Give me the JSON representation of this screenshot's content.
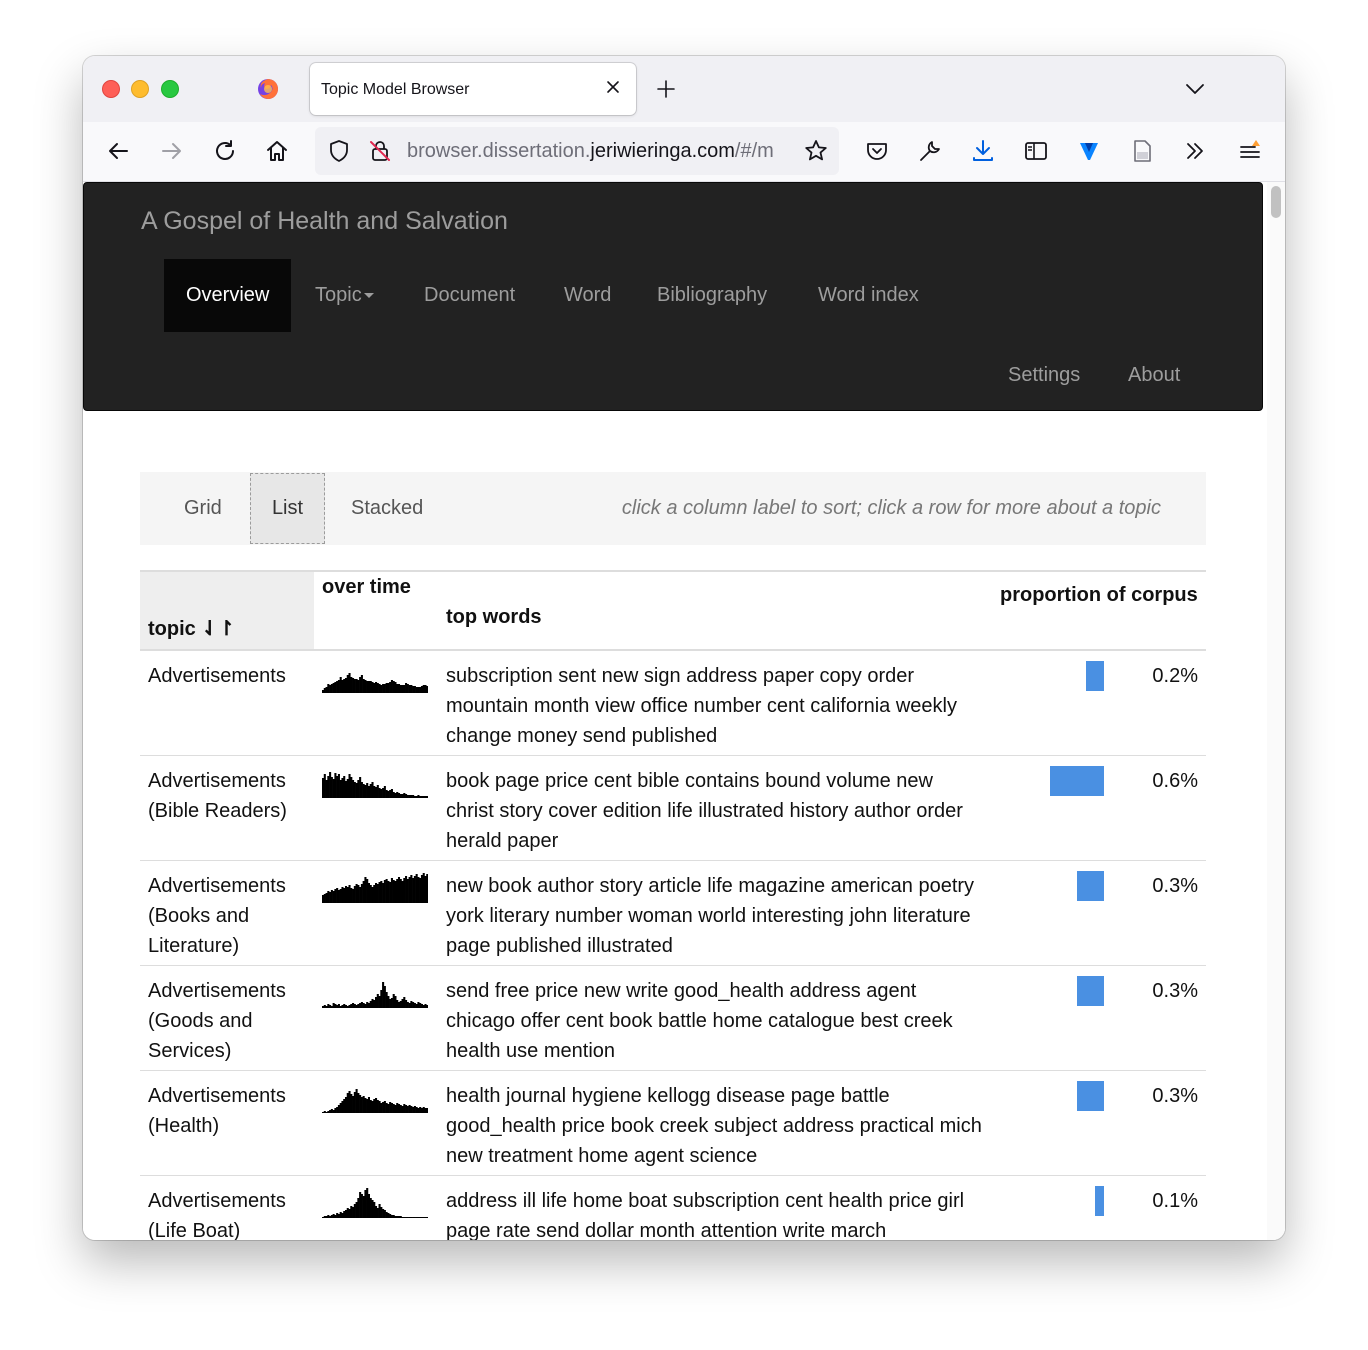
{
  "browser": {
    "tab_title": "Topic Model Browser",
    "url_prefix": "browser.dissertation.",
    "url_domain": "jeriwieringa.com",
    "url_suffix": "/#/m"
  },
  "site": {
    "brand": "A Gospel of Health and Salvation",
    "nav": {
      "overview": "Overview",
      "topic": "Topic",
      "document": "Document",
      "word": "Word",
      "bibliography": "Bibliography",
      "word_index": "Word index",
      "settings": "Settings",
      "about": "About"
    }
  },
  "view_controls": {
    "grid": "Grid",
    "list": "List",
    "stacked": "Stacked",
    "selected": "List",
    "help": "click a column label to sort; click a row for more about a topic"
  },
  "table": {
    "headers": {
      "topic": "topic",
      "sort_icon": "⇃↾",
      "over_time": "over time",
      "top_words": "top words",
      "proportion": "proportion of corpus"
    },
    "rows": [
      {
        "topic": "Advertisements",
        "words": "subscription sent new sign address paper copy order mountain month view office number cent california weekly change money send published",
        "proportion": 0.2,
        "pct_label": "0.2%",
        "trend": [
          3,
          5,
          6,
          9,
          8,
          9,
          10,
          11,
          12,
          13,
          16,
          13,
          14,
          15,
          18,
          20,
          16,
          15,
          14,
          14,
          13,
          16,
          18,
          14,
          13,
          12,
          12,
          12,
          11,
          10,
          11,
          10,
          9,
          8,
          9,
          9,
          10,
          10,
          11,
          13,
          12,
          11,
          9,
          9,
          8,
          8,
          8,
          10,
          9,
          8,
          8,
          7,
          7,
          6,
          6,
          6,
          7,
          8,
          8,
          7
        ]
      },
      {
        "topic": "Advertisements\n(Bible Readers)",
        "words": "book page price cent bible contains bound volume new christ story cover edition life illustrated history author order herald paper",
        "proportion": 0.6,
        "pct_label": "0.6%",
        "trend": [
          20,
          24,
          18,
          22,
          26,
          21,
          19,
          25,
          22,
          24,
          18,
          20,
          22,
          17,
          19,
          24,
          21,
          18,
          16,
          15,
          18,
          21,
          16,
          14,
          13,
          15,
          12,
          14,
          16,
          12,
          11,
          13,
          10,
          9,
          10,
          12,
          8,
          7,
          8,
          9,
          6,
          5,
          6,
          5,
          4,
          4,
          5,
          4,
          3,
          3,
          3,
          3,
          2,
          2,
          3,
          2,
          2,
          2,
          2,
          2
        ]
      },
      {
        "topic": "Advertisements\n(Books and\nLiterature)",
        "words": "new book author story article life magazine american poetry york literary number woman world interesting john literature page published illustrated",
        "proportion": 0.3,
        "pct_label": "0.3%",
        "trend": [
          8,
          9,
          10,
          12,
          11,
          13,
          12,
          14,
          15,
          13,
          14,
          16,
          15,
          17,
          16,
          18,
          15,
          14,
          17,
          19,
          18,
          16,
          19,
          22,
          26,
          24,
          20,
          18,
          16,
          18,
          20,
          19,
          21,
          22,
          20,
          23,
          24,
          22,
          21,
          25,
          23,
          22,
          24,
          26,
          24,
          22,
          25,
          27,
          24,
          26,
          28,
          25,
          27,
          29,
          26,
          25,
          28,
          30,
          27,
          29
        ]
      },
      {
        "topic": "Advertisements\n(Goods and\nServices)",
        "words": "send free price new write good_health address agent chicago offer cent book battle home catalogue best creek health use mention",
        "proportion": 0.3,
        "pct_label": "0.3%",
        "trend": [
          2,
          3,
          2,
          4,
          3,
          2,
          5,
          4,
          3,
          4,
          2,
          3,
          4,
          3,
          2,
          3,
          4,
          5,
          4,
          3,
          4,
          5,
          6,
          5,
          4,
          6,
          5,
          7,
          9,
          8,
          11,
          14,
          12,
          18,
          26,
          22,
          16,
          12,
          9,
          10,
          14,
          12,
          8,
          6,
          7,
          9,
          11,
          8,
          6,
          5,
          7,
          6,
          5,
          4,
          6,
          5,
          4,
          3,
          4,
          3
        ]
      },
      {
        "topic": "Advertisements\n(Health)",
        "words": "health journal hygiene kellogg disease page battle good_health price book creek subject address practical mich new treatment home agent science",
        "proportion": 0.3,
        "pct_label": "0.3%",
        "trend": [
          1,
          2,
          1,
          2,
          3,
          4,
          3,
          5,
          6,
          8,
          10,
          12,
          14,
          16,
          20,
          22,
          19,
          17,
          21,
          24,
          20,
          18,
          16,
          17,
          15,
          14,
          16,
          13,
          12,
          14,
          15,
          13,
          12,
          10,
          11,
          12,
          10,
          9,
          11,
          10,
          9,
          8,
          10,
          9,
          8,
          7,
          9,
          8,
          7,
          8,
          7,
          6,
          7,
          6,
          5,
          6,
          5,
          6,
          5,
          5
        ]
      },
      {
        "topic": "Advertisements\n(Life Boat)",
        "words": "address ill life home boat subscription cent health price girl page rate send dollar month attention write march",
        "proportion": 0.1,
        "pct_label": "0.1%",
        "trend": [
          1,
          2,
          2,
          3,
          2,
          3,
          4,
          3,
          5,
          4,
          6,
          5,
          7,
          8,
          10,
          9,
          12,
          11,
          14,
          16,
          20,
          26,
          24,
          22,
          28,
          30,
          24,
          20,
          18,
          16,
          12,
          10,
          14,
          11,
          9,
          8,
          6,
          5,
          4,
          3,
          3,
          2,
          2,
          2,
          2,
          1,
          1,
          1,
          1,
          1,
          1,
          1,
          1,
          1,
          1,
          1,
          1,
          1,
          1,
          1
        ]
      }
    ]
  },
  "colors": {
    "navbar_bg": "#222222",
    "bar": "#4a90e2"
  }
}
